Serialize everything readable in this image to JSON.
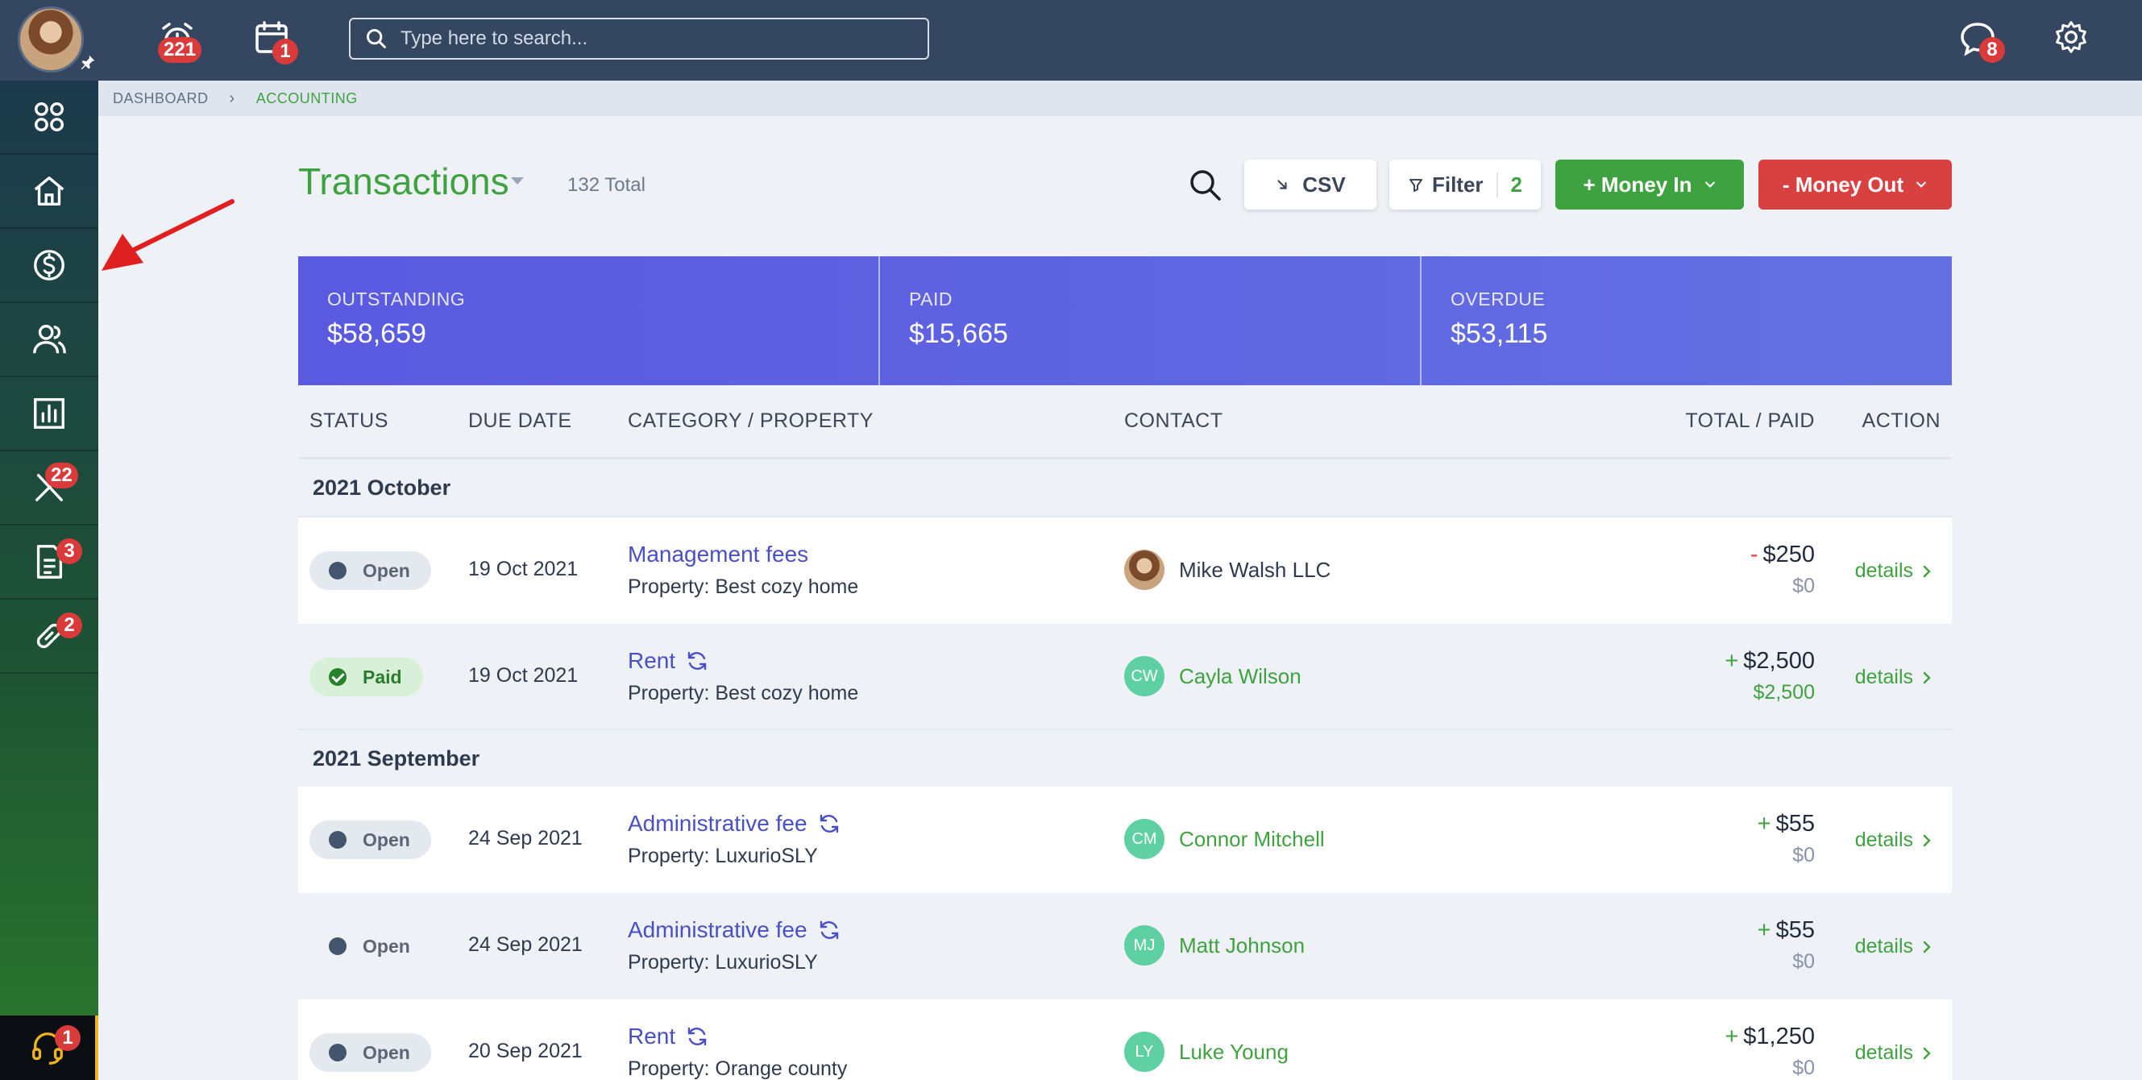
{
  "topbar": {
    "alarm_badge": "221",
    "calendar_badge": "1",
    "search_placeholder": "Type here to search...",
    "messages_badge": "8"
  },
  "sidebar": {
    "tools_badge": "22",
    "documents_badge": "3",
    "links_badge": "2",
    "support_badge": "1"
  },
  "breadcrumb": {
    "dashboard": "DASHBOARD",
    "current": "ACCOUNTING"
  },
  "header": {
    "title": "Transactions",
    "total": "132 Total",
    "csv_label": "CSV",
    "filter_label": "Filter",
    "filter_count": "2",
    "money_in_label": "+ Money In",
    "money_out_label": "- Money Out"
  },
  "summary": {
    "outstanding_label": "OUTSTANDING",
    "outstanding_value": "$58,659",
    "paid_label": "PAID",
    "paid_value": "$15,665",
    "overdue_label": "OVERDUE",
    "overdue_value": "$53,115"
  },
  "table": {
    "columns": {
      "status": "STATUS",
      "due_date": "DUE DATE",
      "category": "CATEGORY / PROPERTY",
      "contact": "CONTACT",
      "total": "TOTAL / PAID",
      "action": "ACTION"
    },
    "groups": [
      "2021 October",
      "2021 September"
    ],
    "rows": [
      {
        "status": "Open",
        "due": "19 Oct 2021",
        "category": "Management fees",
        "property": "Property: Best cozy home",
        "contact": "Mike Walsh LLC",
        "initials": "",
        "sign": "-",
        "total": "$250",
        "paid": "$0",
        "action": "details"
      },
      {
        "status": "Paid",
        "due": "19 Oct 2021",
        "category": "Rent",
        "property": "Property: Best cozy home",
        "contact": "Cayla Wilson",
        "initials": "CW",
        "sign": "+",
        "total": "$2,500",
        "paid": "$2,500",
        "action": "details"
      },
      {
        "status": "Open",
        "due": "24 Sep 2021",
        "category": "Administrative fee",
        "property": "Property: LuxurioSLY",
        "contact": "Connor Mitchell",
        "initials": "CM",
        "sign": "+",
        "total": "$55",
        "paid": "$0",
        "action": "details"
      },
      {
        "status": "Open",
        "due": "24 Sep 2021",
        "category": "Administrative fee",
        "property": "Property: LuxurioSLY",
        "contact": "Matt Johnson",
        "initials": "MJ",
        "sign": "+",
        "total": "$55",
        "paid": "$0",
        "action": "details"
      },
      {
        "status": "Open",
        "due": "20 Sep 2021",
        "category": "Rent",
        "property": "Property: Orange county",
        "contact": "Luke Young",
        "initials": "LY",
        "sign": "+",
        "total": "$1,250",
        "paid": "$0",
        "action": "details"
      }
    ]
  }
}
